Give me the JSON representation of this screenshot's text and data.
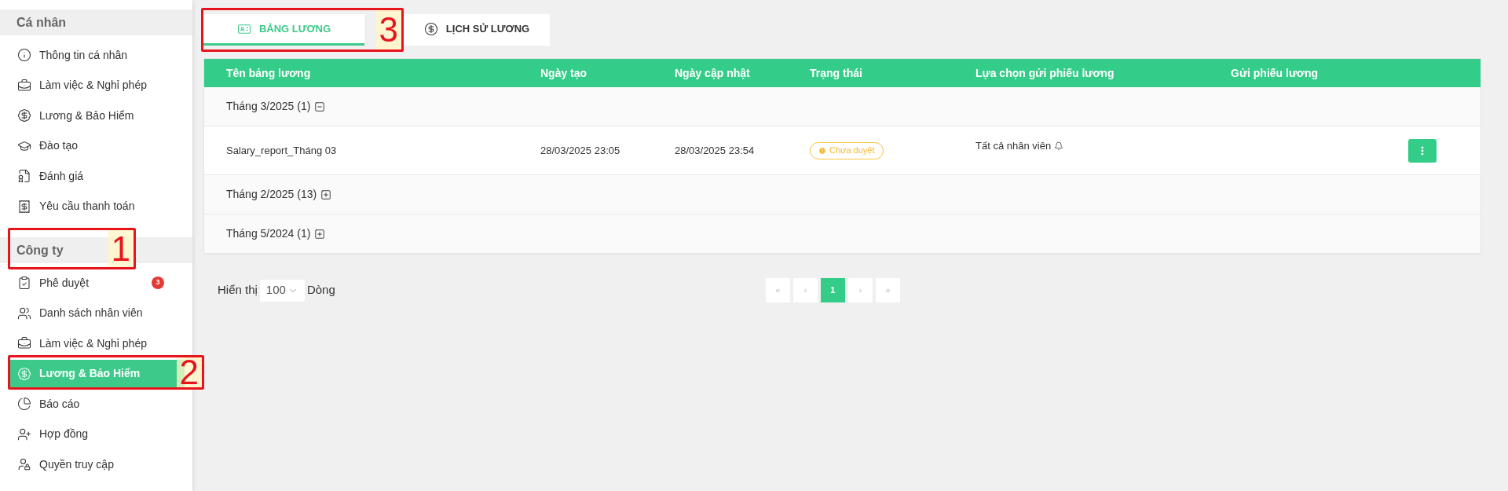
{
  "sidebar": {
    "sections": [
      {
        "title": "Cá nhân",
        "items": [
          {
            "label": "Thông tin cá nhân",
            "selected": false
          },
          {
            "label": "Làm việc & Nghỉ phép",
            "selected": false
          },
          {
            "label": "Lương & Bảo Hiểm",
            "selected": false
          },
          {
            "label": "Đào tạo",
            "selected": false
          },
          {
            "label": "Đánh giá",
            "selected": false
          },
          {
            "label": "Yêu cầu thanh toán",
            "selected": false
          }
        ]
      },
      {
        "title": "Công ty",
        "items": [
          {
            "label": "Phê duyệt",
            "selected": false,
            "badge": "3"
          },
          {
            "label": "Danh sách nhân viên",
            "selected": false
          },
          {
            "label": "Làm việc & Nghỉ phép",
            "selected": false
          },
          {
            "label": "Lương & Bảo Hiểm",
            "selected": true
          },
          {
            "label": "Báo cáo",
            "selected": false
          },
          {
            "label": "Hợp đồng",
            "selected": false
          },
          {
            "label": "Quyền truy cập",
            "selected": false
          }
        ]
      }
    ]
  },
  "tabs": [
    {
      "label": "BẢNG LƯƠNG",
      "selected": true
    },
    {
      "label": "LỊCH SỬ LƯƠNG",
      "selected": false
    }
  ],
  "table": {
    "columns": [
      "Tên bảng lương",
      "Ngày tạo",
      "Ngày cập nhật",
      "Trạng thái",
      "Lựa chọn gửi phiếu lương",
      "Gửi phiếu lương"
    ],
    "rows": [
      {
        "kind": "group",
        "label": "Tháng 3/2025 (1)",
        "expanded": true
      },
      {
        "kind": "data",
        "name": "Salary_report_Tháng 03",
        "created": "28/03/2025 23:05",
        "updated": "28/03/2025 23:54",
        "status": "Chưa duyệt",
        "send_option": "Tất cả nhân viên"
      },
      {
        "kind": "group",
        "label": "Tháng 2/2025 (13)",
        "expanded": false
      },
      {
        "kind": "group",
        "label": "Tháng 5/2024 (1)",
        "expanded": false
      }
    ]
  },
  "pagination": {
    "show_label": "Hiển thị",
    "page_size": "100",
    "rows_label": "Dòng",
    "first": "«",
    "prev": "‹",
    "pages": [
      {
        "label": "1",
        "selected": true
      }
    ],
    "next": "›",
    "last": "»"
  },
  "annotations": [
    {
      "number": "1"
    },
    {
      "number": "2"
    },
    {
      "number": "3"
    }
  ]
}
